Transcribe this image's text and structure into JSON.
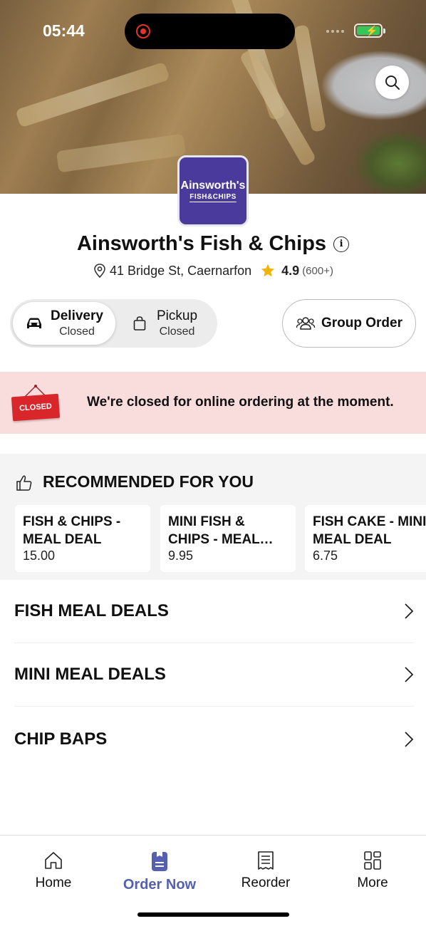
{
  "status_bar": {
    "time": "05:44"
  },
  "hero": {
    "search_icon": "search-icon"
  },
  "restaurant": {
    "logo_line1": "Ainsworth's",
    "logo_line2": "FISH&CHIPS",
    "name": "Ainsworth's Fish & Chips",
    "address": "41 Bridge St, Caernarfon",
    "rating": "4.9",
    "rating_count": "(600+)"
  },
  "order_mode": {
    "delivery_label": "Delivery",
    "delivery_status": "Closed",
    "pickup_label": "Pickup",
    "pickup_status": "Closed",
    "selected": "delivery"
  },
  "group_order": {
    "label": "Group Order"
  },
  "closed_banner": {
    "sign": "CLOSED",
    "message": "We're closed for online ordering at the moment."
  },
  "recommended": {
    "title": "RECOMMENDED FOR YOU",
    "items": [
      {
        "name": "FISH & CHIPS - MEAL DEAL",
        "price": "15.00"
      },
      {
        "name": "MINI FISH & CHIPS - MEAL DEAL",
        "price": "9.95"
      },
      {
        "name": "FISH CAKE - MINI MEAL DEAL",
        "price": "6.75"
      }
    ]
  },
  "categories": [
    {
      "label": "FISH MEAL DEALS"
    },
    {
      "label": "MINI MEAL DEALS"
    },
    {
      "label": "CHIP BAPS"
    }
  ],
  "tabbar": {
    "tabs": [
      {
        "label": "Home",
        "icon": "home-icon"
      },
      {
        "label": "Order Now",
        "icon": "order-icon"
      },
      {
        "label": "Reorder",
        "icon": "receipt-icon"
      },
      {
        "label": "More",
        "icon": "grid-icon"
      }
    ],
    "active": "Order Now"
  },
  "colors": {
    "accent": "#5560b0",
    "banner_bg": "#f9dcdc",
    "sign_red": "#d8262b",
    "logo_bg": "#4a3a9c",
    "star": "#f5b301"
  }
}
